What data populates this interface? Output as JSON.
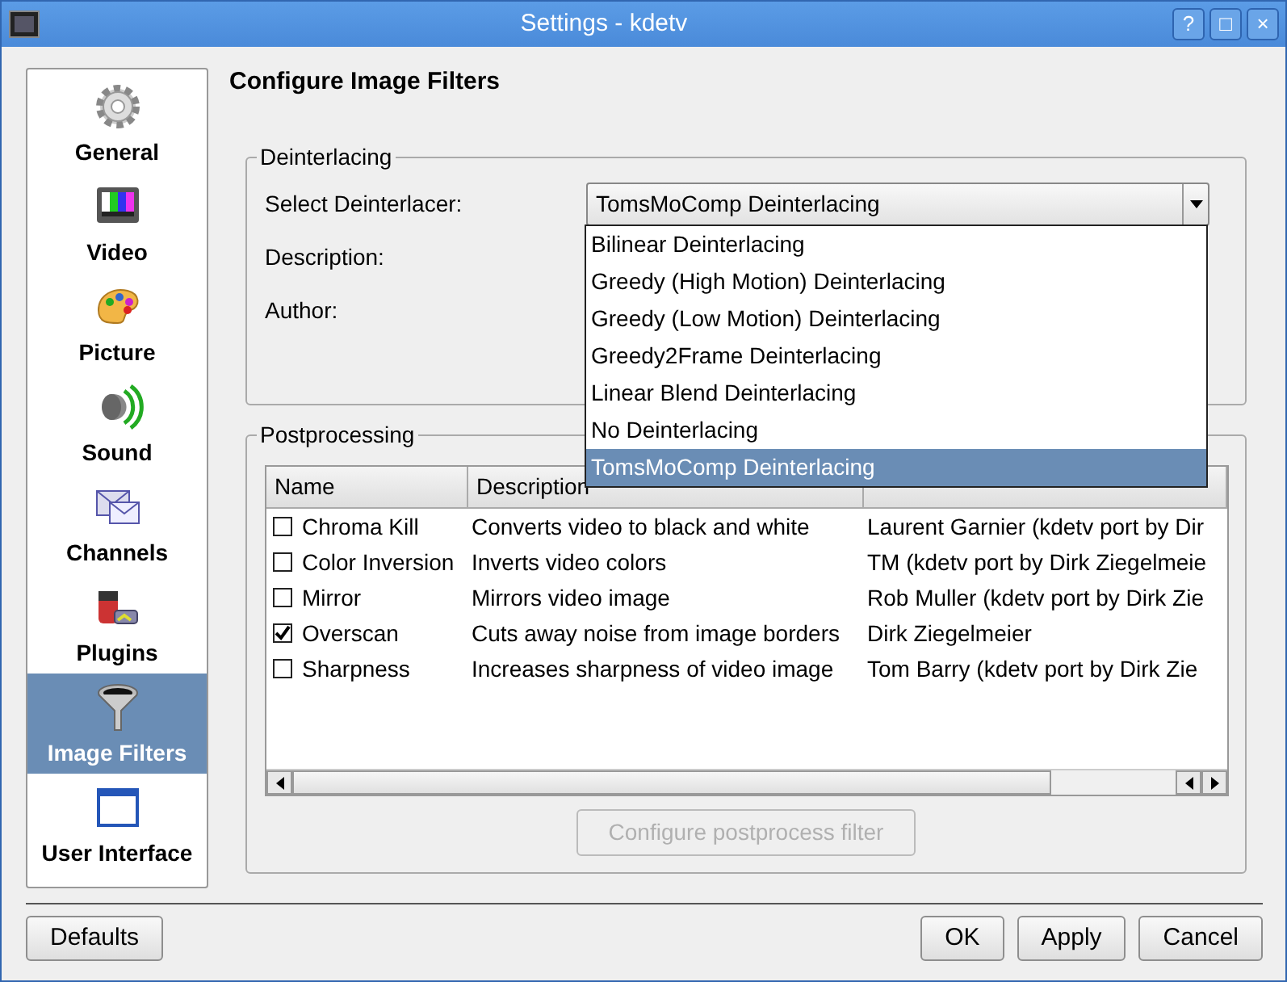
{
  "window": {
    "title": "Settings - kdetv",
    "buttons": [
      "?",
      "□",
      "×"
    ]
  },
  "sidebar": {
    "items": [
      {
        "label": "General",
        "selected": false
      },
      {
        "label": "Video",
        "selected": false
      },
      {
        "label": "Picture",
        "selected": false
      },
      {
        "label": "Sound",
        "selected": false
      },
      {
        "label": "Channels",
        "selected": false
      },
      {
        "label": "Plugins",
        "selected": false
      },
      {
        "label": "Image Filters",
        "selected": true
      },
      {
        "label": "User Interface",
        "selected": false
      }
    ]
  },
  "page_title": "Configure Image Filters",
  "deinterlacing": {
    "legend": "Deinterlacing",
    "select_label": "Select Deinterlacer:",
    "select_value": "TomsMoComp Deinterlacing",
    "description_label": "Description:",
    "author_label": "Author:",
    "options": [
      {
        "label": "Bilinear Deinterlacing",
        "selected": false
      },
      {
        "label": "Greedy (High Motion) Deinterlacing",
        "selected": false
      },
      {
        "label": "Greedy (Low Motion) Deinterlacing",
        "selected": false
      },
      {
        "label": "Greedy2Frame Deinterlacing",
        "selected": false
      },
      {
        "label": "Linear Blend Deinterlacing",
        "selected": false
      },
      {
        "label": "No Deinterlacing",
        "selected": false
      },
      {
        "label": "TomsMoComp Deinterlacing",
        "selected": true
      }
    ]
  },
  "postprocessing": {
    "legend": "Postprocessing",
    "columns": [
      "Name",
      "Description"
    ],
    "rows": [
      {
        "name": "Chroma Kill",
        "description": "Converts video to black and white",
        "column_3": "Laurent Garnier (kdetv port by Dir",
        "checked": false
      },
      {
        "name": "Color Inversion",
        "description": "Inverts video colors",
        "column_3": "TM (kdetv port by Dirk Ziegelmeie",
        "checked": false
      },
      {
        "name": "Mirror",
        "description": "Mirrors video image",
        "column_3": "Rob Muller (kdetv port by Dirk Zie",
        "checked": false
      },
      {
        "name": "Overscan",
        "description": "Cuts away noise from image borders",
        "column_3": "Dirk Ziegelmeier",
        "checked": true
      },
      {
        "name": "Sharpness",
        "description": "Increases sharpness of video image",
        "column_3": "Tom Barry (kdetv port by Dirk Zie",
        "checked": false
      }
    ],
    "configure_button": {
      "label": "Configure postprocess filter",
      "disabled": true
    }
  },
  "footer": {
    "left_buttons": [
      "Defaults"
    ],
    "right_buttons": [
      "OK",
      "Apply",
      "Cancel"
    ]
  }
}
